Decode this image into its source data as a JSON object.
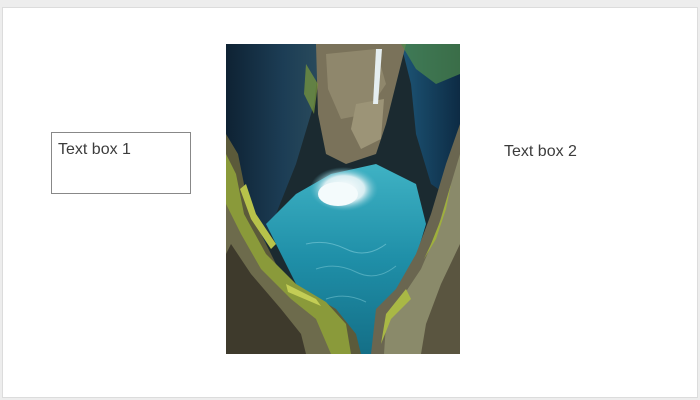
{
  "slide": {
    "text_box_1": "Text box 1",
    "text_box_2": "Text box 2"
  },
  "image": {
    "subject": "canyon-waterfall-photo",
    "colors": {
      "water": "#1f8fa8",
      "foam": "#e8f4f6",
      "rock_shadow": "#1e2a2e",
      "rock": "#6b6550",
      "moss": "#9aa63a",
      "sky_rock": "#12324a"
    }
  }
}
